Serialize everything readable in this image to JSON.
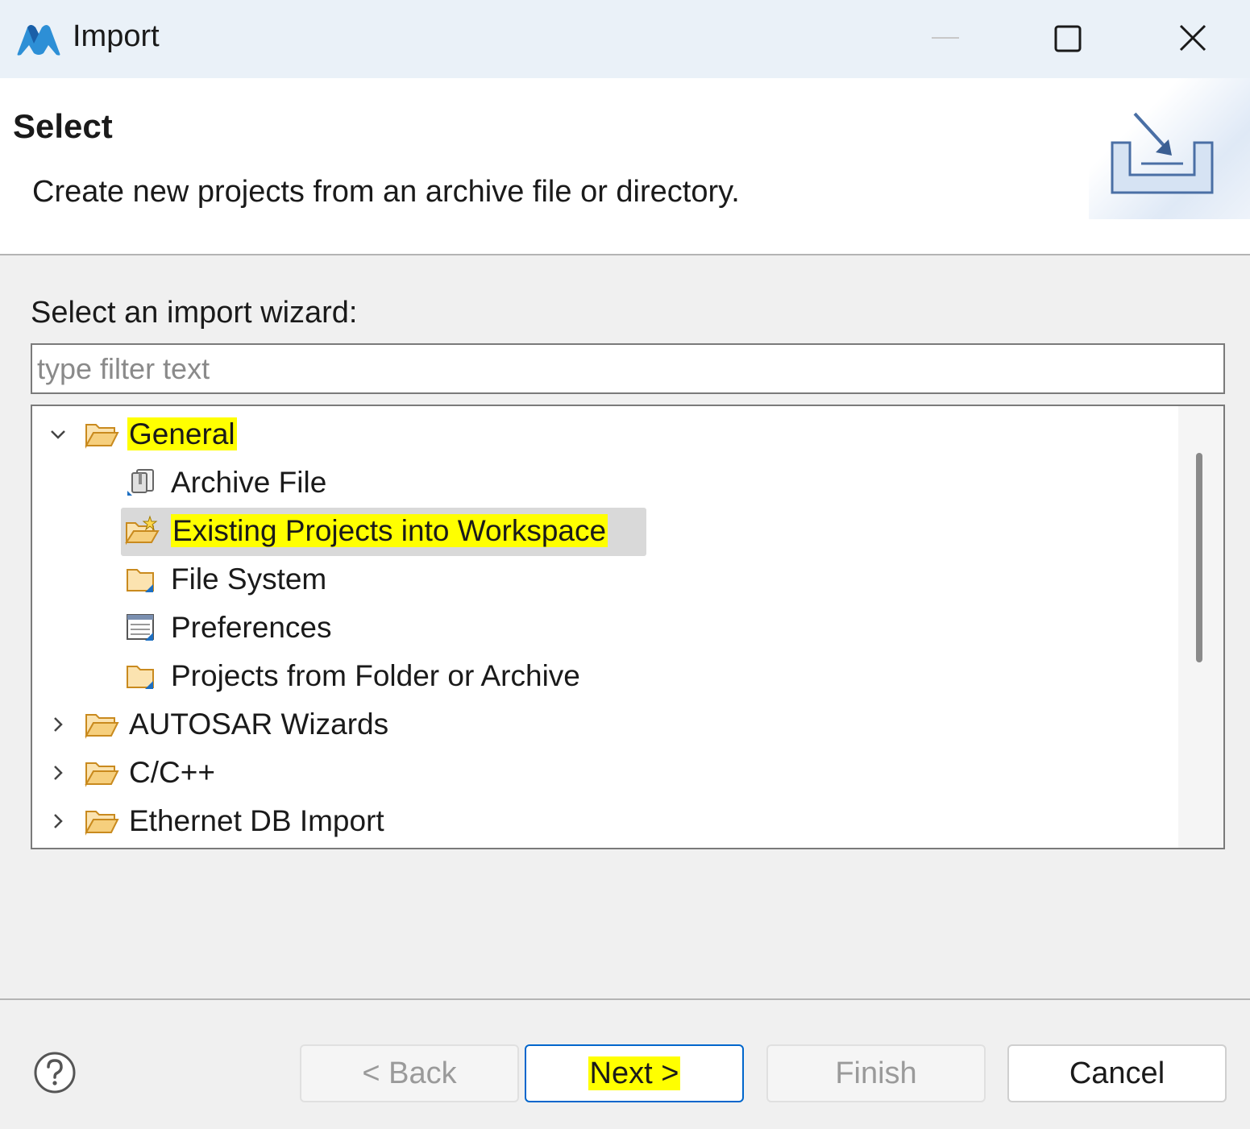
{
  "window": {
    "title": "Import",
    "minimize_icon": "minimize-icon",
    "maximize_icon": "maximize-icon",
    "close_icon": "close-icon"
  },
  "header": {
    "title": "Select",
    "description": "Create new projects from an archive file or directory.",
    "banner_icon": "import-wizard-banner-icon"
  },
  "wizard": {
    "prompt": "Select an import wizard:",
    "filter": {
      "value": "",
      "placeholder": "type filter text"
    },
    "tree": [
      {
        "label": "General",
        "expanded": true,
        "highlighted": true,
        "icon": "folder-open-icon"
      },
      {
        "label": "Archive File",
        "icon": "archive-file-icon"
      },
      {
        "label": "Existing Projects into Workspace",
        "icon": "existing-projects-icon",
        "selected": true,
        "highlighted": true
      },
      {
        "label": "File System",
        "icon": "file-system-icon"
      },
      {
        "label": "Preferences",
        "icon": "preferences-icon"
      },
      {
        "label": "Projects from Folder or Archive",
        "icon": "projects-folder-icon"
      },
      {
        "label": "AUTOSAR Wizards",
        "expanded": false,
        "icon": "folder-open-icon"
      },
      {
        "label": "C/C++",
        "expanded": false,
        "icon": "folder-open-icon"
      },
      {
        "label": "Ethernet DB Import",
        "expanded": false,
        "icon": "folder-open-icon"
      }
    ]
  },
  "footer": {
    "help_icon": "help-icon",
    "back_label": "< Back",
    "next_label": "Next >",
    "finish_label": "Finish",
    "cancel_label": "Cancel"
  },
  "colors": {
    "highlight": "#ffff00",
    "titlebar_bg": "#eaf1f8",
    "body_bg": "#f0f0f0",
    "primary_border": "#0066cc",
    "folder": "#f2c46d"
  }
}
